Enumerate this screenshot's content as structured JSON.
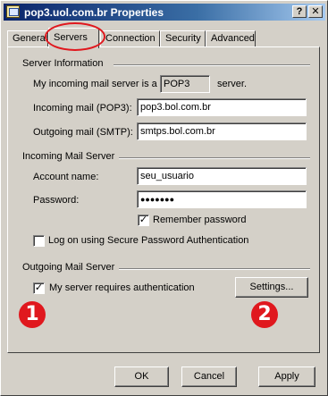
{
  "window": {
    "title": "pop3.uol.com.br Properties",
    "help_glyph": "?",
    "close_glyph": "✕"
  },
  "tabs": [
    {
      "label": "General"
    },
    {
      "label": "Servers"
    },
    {
      "label": "Connection"
    },
    {
      "label": "Security"
    },
    {
      "label": "Advanced"
    }
  ],
  "server_info": {
    "group_label": "Server Information",
    "incoming_type_prefix": "My incoming mail server is a",
    "incoming_type_value": "POP3",
    "incoming_type_suffix": "server.",
    "incoming_label": "Incoming mail (POP3):",
    "incoming_value": "pop3.bol.com.br",
    "outgoing_label": "Outgoing mail (SMTP):",
    "outgoing_value": "smtps.bol.com.br"
  },
  "incoming_server": {
    "group_label": "Incoming Mail Server",
    "account_label": "Account name:",
    "account_value": "seu_usuario",
    "password_label": "Password:",
    "password_value": "●●●●●●●",
    "remember_label": "Remember password",
    "remember_checked": true,
    "spa_label": "Log on using Secure Password Authentication",
    "spa_checked": false
  },
  "outgoing_server": {
    "group_label": "Outgoing Mail Server",
    "auth_label": "My server requires authentication",
    "auth_checked": true,
    "settings_button": "Settings..."
  },
  "buttons": {
    "ok": "OK",
    "cancel": "Cancel",
    "apply": "Apply"
  },
  "annotations": {
    "badge1": "1",
    "badge2": "2",
    "badge_color": "#e0181e"
  }
}
